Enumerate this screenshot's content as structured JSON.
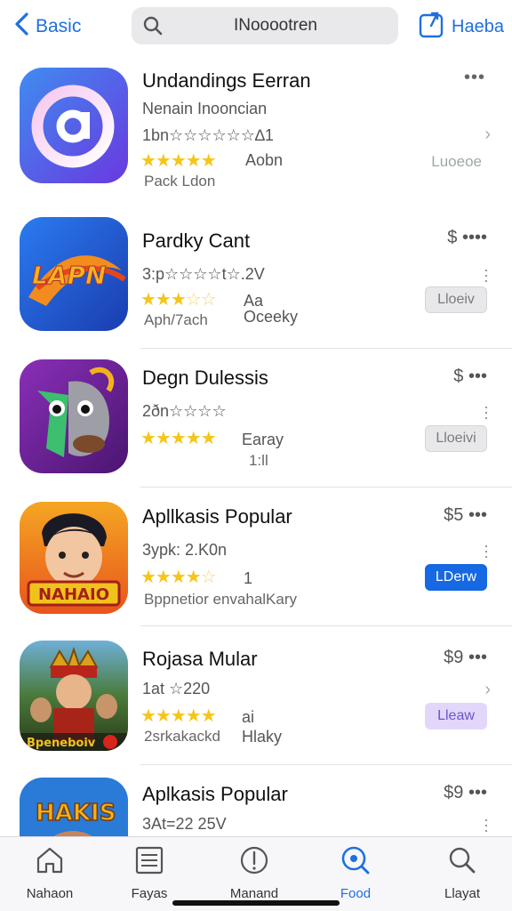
{
  "nav": {
    "back_label": "Basic",
    "search_text": "INooootren",
    "share_label": "Haeba"
  },
  "apps": [
    {
      "name": "Undandings Eerran",
      "subtitle": "Nenain Inooncian",
      "rating_text": "1bn☆☆☆☆☆☆∆1",
      "stars": "★★★★★",
      "rating_label": "Aobn",
      "meta": "Pack Ldon",
      "side_label": "Luoeoe"
    },
    {
      "name": "Pardky Cant",
      "subtitle": "3:p☆☆☆☆t☆.2V",
      "stars": "★★★",
      "stars_empty": "☆☆",
      "rating_label": "Aa",
      "rating_label2": "Oceeky",
      "meta": "Aph/7ach",
      "price": "$",
      "button_label": "Lloeiv"
    },
    {
      "name": "Degn Dulessis",
      "subtitle": "2ðn☆☆☆☆",
      "stars": "★★★★★",
      "rating_label": "Earay",
      "meta": "1:ll",
      "price": "$",
      "button_label": "Lloeivi"
    },
    {
      "name": "Apllkasis Popular",
      "subtitle": "3ypk: 2.K0n",
      "stars": "★★★★",
      "stars_empty": "☆",
      "rating_label": "1",
      "meta": "Bppnetior envahalKary",
      "price": "$5",
      "button_label": "LDerw"
    },
    {
      "name": "Rojasa Mular",
      "subtitle": "1at ☆220",
      "stars": "★★★★★",
      "rating_label": "ai",
      "meta": "2srkakackd",
      "meta2": "Hlaky",
      "price": "$9",
      "button_label": "Lleaw"
    },
    {
      "name": "Aplkasis Popular",
      "subtitle": "3At=22 25V",
      "price": "$9"
    }
  ],
  "tabs": [
    {
      "label": "Nahaon",
      "icon": "home-icon"
    },
    {
      "label": "Fayas",
      "icon": "list-icon"
    },
    {
      "label": "Manand",
      "icon": "compass-icon"
    },
    {
      "label": "Food",
      "icon": "search-circle-icon"
    },
    {
      "label": "Llayat",
      "icon": "search-icon"
    }
  ],
  "colors": {
    "accent": "#1f6fe0",
    "star": "#f5c518",
    "button_blue": "#1668e3",
    "button_lilac": "#e2d6fb"
  }
}
